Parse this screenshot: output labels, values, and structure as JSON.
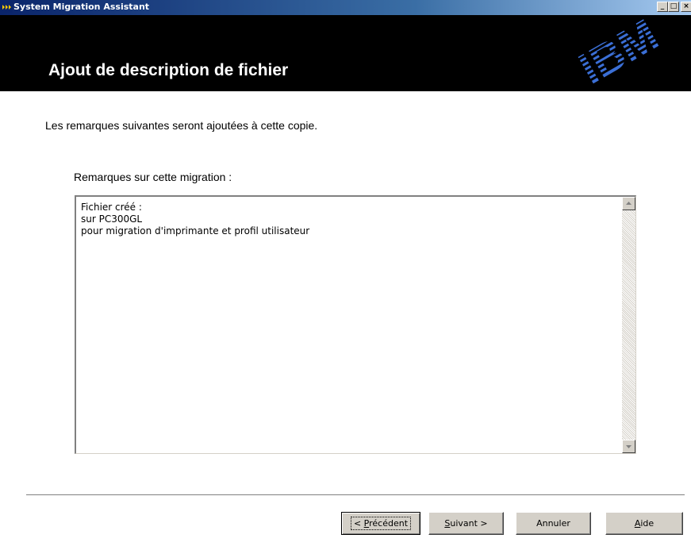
{
  "window": {
    "title": "System Migration Assistant",
    "controls": {
      "minimize": "_",
      "maximize": "□",
      "close": "×"
    }
  },
  "header": {
    "page_title": "Ajout de description de fichier",
    "logo": "IBM"
  },
  "content": {
    "intro": "Les remarques suivantes seront ajoutées à cette copie.",
    "notes_label": "Remarques sur cette migration :",
    "notes_lines": [
      "Fichier créé :",
      "sur PC300GL",
      "pour migration d'imprimante et profil utilisateur"
    ]
  },
  "buttons": {
    "prev": {
      "prefix": "< ",
      "mnemonic": "P",
      "rest": "récédent"
    },
    "next": {
      "mnemonic": "S",
      "rest": "uivant >"
    },
    "cancel": "Annuler",
    "help": {
      "mnemonic": "A",
      "rest": "ide"
    }
  },
  "colors": {
    "titlebar_start": "#0a246a",
    "titlebar_end": "#a6caf0",
    "header_bg": "#000000",
    "logo_blue": "#3b6fd6",
    "button_face": "#d4d0c8"
  },
  "icons": {
    "app": "migration-arrows-icon",
    "scroll_up": "triangle-up-icon",
    "scroll_down": "triangle-down-icon"
  }
}
